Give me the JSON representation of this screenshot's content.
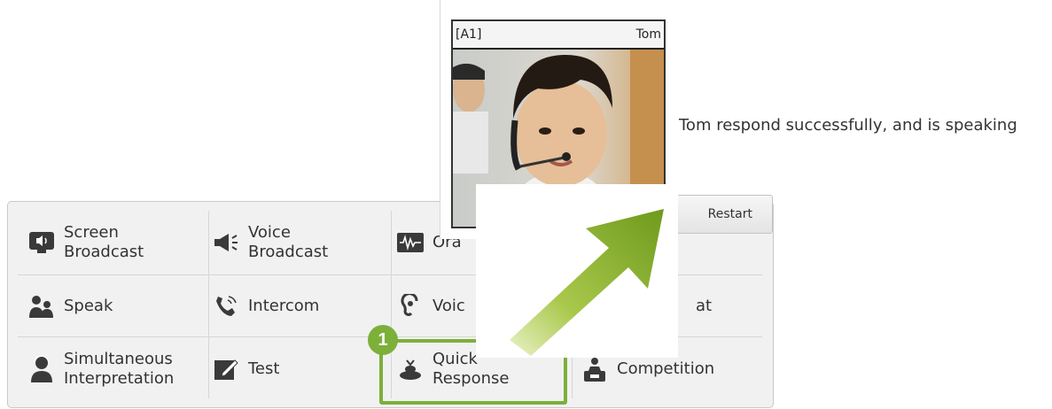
{
  "popup": {
    "seat": "[A1]",
    "student": "Tom",
    "status_message": "Tom respond successfully, and is speaking",
    "restart_label": "Restart"
  },
  "toolbar": {
    "screen_broadcast": "Screen\nBroadcast",
    "voice_broadcast": "Voice\nBroadcast",
    "oral": "Ora",
    "speak": "Speak",
    "intercom": "Intercom",
    "voice": "Voic",
    "chat": "at",
    "simultaneous_interpretation": "Simultaneous\nInterpretation",
    "test": "Test",
    "quick_response": "Quick\nResponse",
    "competition": "Competition"
  },
  "callout": {
    "step_number": "1"
  },
  "colors": {
    "highlight": "#7cb03a",
    "icon_dark": "#3a3a3a"
  },
  "icons": {
    "screen_broadcast": "monitor-speaker-icon",
    "voice_broadcast": "megaphone-icon",
    "oral": "waveform-icon",
    "speak": "people-talk-icon",
    "intercom": "phone-icon",
    "voice": "ear-icon",
    "simultaneous_interpretation": "interpreter-icon",
    "test": "pencil-paper-icon",
    "quick_response": "buzzer-icon",
    "competition": "trophy-box-icon",
    "callout_arrow": "green-arrow-icon"
  }
}
